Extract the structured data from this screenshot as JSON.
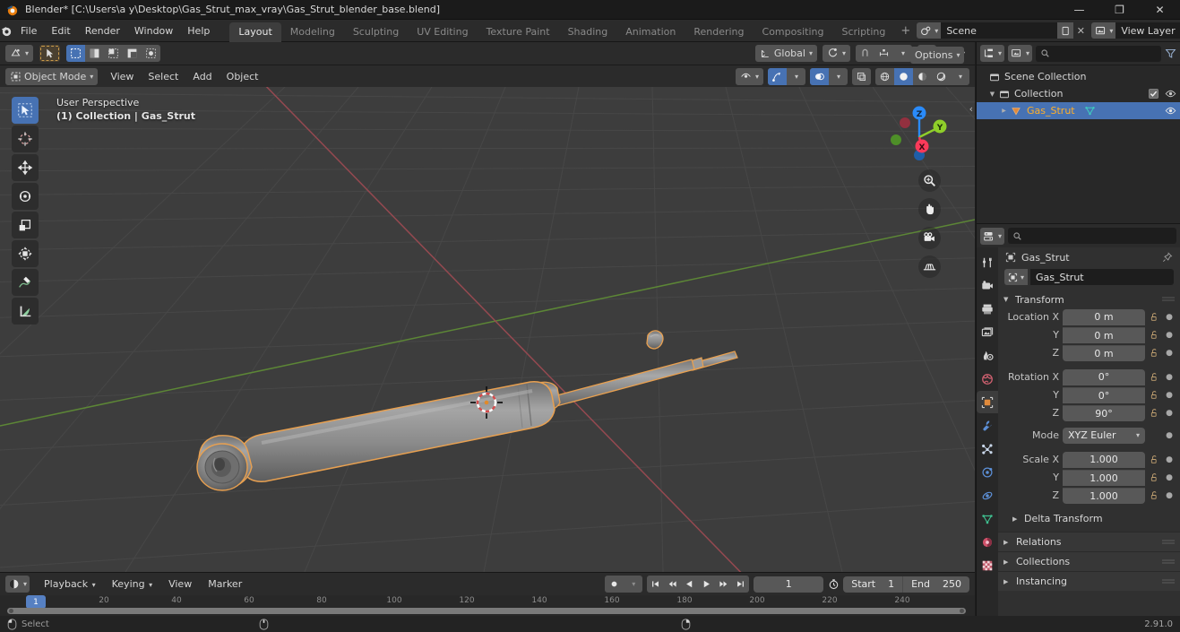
{
  "window": {
    "title": "Blender* [C:\\Users\\a y\\Desktop\\Gas_Strut_max_vray\\Gas_Strut_blender_base.blend]",
    "minimize": "—",
    "maximize": "❐",
    "close": "✕"
  },
  "topbar": {
    "menus": [
      "File",
      "Edit",
      "Render",
      "Window",
      "Help"
    ],
    "workspaces": [
      {
        "label": "Layout",
        "active": true
      },
      {
        "label": "Modeling",
        "active": false
      },
      {
        "label": "Sculpting",
        "active": false
      },
      {
        "label": "UV Editing",
        "active": false
      },
      {
        "label": "Texture Paint",
        "active": false
      },
      {
        "label": "Shading",
        "active": false
      },
      {
        "label": "Animation",
        "active": false
      },
      {
        "label": "Rendering",
        "active": false
      },
      {
        "label": "Compositing",
        "active": false
      },
      {
        "label": "Scripting",
        "active": false
      }
    ],
    "add_workspace": "+",
    "scene_name": "Scene",
    "view_layer_name": "View Layer"
  },
  "viewport_header": {
    "editor_type_icon": "editor-type-icon",
    "mode": "Object Mode",
    "menus": [
      "View",
      "Select",
      "Add",
      "Object"
    ],
    "transform_orientation": "Global",
    "options_label": "Options",
    "select_modes": [
      "tweak",
      "select-box",
      "select-circle",
      "select-lasso",
      "select-extend"
    ],
    "shading_modes": [
      "wireframe",
      "solid",
      "material-preview",
      "rendered"
    ],
    "active_shading": "solid"
  },
  "viewport_overlay": {
    "line1": "User Perspective",
    "line2": "(1) Collection | Gas_Strut"
  },
  "gizmo": {
    "axis_x": "X",
    "axis_y": "Y",
    "axis_z": "Z",
    "color_x": "#fa3a5a",
    "color_y": "#8fcf2a",
    "color_z": "#2a8bfa"
  },
  "nav_buttons": [
    "zoom-icon",
    "pan-hand-icon",
    "camera-icon",
    "grid-ortho-icon"
  ],
  "toolbar": {
    "tools": [
      {
        "name": "select-box-tool",
        "active": true
      },
      {
        "name": "cursor-tool",
        "active": false
      },
      {
        "name": "move-tool",
        "active": false
      },
      {
        "name": "rotate-tool",
        "active": false
      },
      {
        "name": "scale-tool",
        "active": false
      },
      {
        "name": "transform-tool",
        "active": false
      },
      {
        "name": "annotate-tool",
        "active": false
      },
      {
        "name": "measure-tool",
        "active": false
      }
    ]
  },
  "scene": {
    "object_color": "#8c8c8c",
    "outline_color": "#e8a050",
    "grid_color": "#4a4a4a",
    "axis_x_color": "#9a4a52",
    "axis_y_color": "#5e8a36",
    "background": "#3d3d3d"
  },
  "outliner": {
    "search_placeholder": "",
    "rows": [
      {
        "label": "Scene Collection",
        "icon": "collection-icon",
        "indent": 0,
        "selected": false,
        "expand": "",
        "checkbox": false,
        "eye": false
      },
      {
        "label": "Collection",
        "icon": "collection-icon",
        "indent": 1,
        "selected": false,
        "expand": "▼",
        "checkbox": true,
        "eye": true
      },
      {
        "label": "Gas_Strut",
        "icon": "mesh-object-icon",
        "indent": 2,
        "selected": true,
        "expand": "▶",
        "checkbox": false,
        "eye": true
      }
    ]
  },
  "properties": {
    "search_placeholder": "",
    "breadcrumb_object": "Gas_Strut",
    "object_name_value": "Gas_Strut",
    "tabs": [
      {
        "name": "tool-tab",
        "active": false
      },
      {
        "name": "render-tab",
        "active": false
      },
      {
        "name": "output-tab",
        "active": false
      },
      {
        "name": "view-layer-tab",
        "active": false
      },
      {
        "name": "scene-tab",
        "active": false
      },
      {
        "name": "world-tab",
        "active": false
      },
      {
        "name": "object-tab",
        "active": true
      },
      {
        "name": "modifier-tab",
        "active": false
      },
      {
        "name": "particles-tab",
        "active": false
      },
      {
        "name": "physics-tab",
        "active": false
      },
      {
        "name": "constraints-tab",
        "active": false
      },
      {
        "name": "object-data-tab",
        "active": false
      },
      {
        "name": "material-tab",
        "active": false
      },
      {
        "name": "texture-tab",
        "active": false
      }
    ],
    "transform": {
      "title": "Transform",
      "location": {
        "label_x": "Location X",
        "label_y": "Y",
        "label_z": "Z",
        "x": "0 m",
        "y": "0 m",
        "z": "0 m"
      },
      "rotation": {
        "label_x": "Rotation X",
        "label_y": "Y",
        "label_z": "Z",
        "x": "0°",
        "y": "0°",
        "z": "90°"
      },
      "mode_label": "Mode",
      "mode_value": "XYZ Euler",
      "scale": {
        "label_x": "Scale X",
        "label_y": "Y",
        "label_z": "Z",
        "x": "1.000",
        "y": "1.000",
        "z": "1.000"
      },
      "delta_transform": "Delta Transform"
    },
    "closed_panels": [
      "Relations",
      "Collections",
      "Instancing"
    ]
  },
  "timeline": {
    "menus": [
      "Playback",
      "Keying",
      "View",
      "Marker"
    ],
    "playback_controls": [
      "jump-start-icon",
      "prev-keyframe-icon",
      "play-reverse-icon",
      "play-icon",
      "next-keyframe-icon",
      "jump-end-icon"
    ],
    "record_icon": "auto-keying-icon",
    "current_frame": "1",
    "start_label": "Start",
    "start_value": "1",
    "end_label": "End",
    "end_value": "250",
    "ticks": [
      "20",
      "40",
      "60",
      "80",
      "100",
      "120",
      "140",
      "160",
      "180",
      "200",
      "220",
      "240"
    ],
    "playhead_label": "1"
  },
  "statusbar": {
    "select_label": "Select",
    "version": "2.91.0"
  }
}
